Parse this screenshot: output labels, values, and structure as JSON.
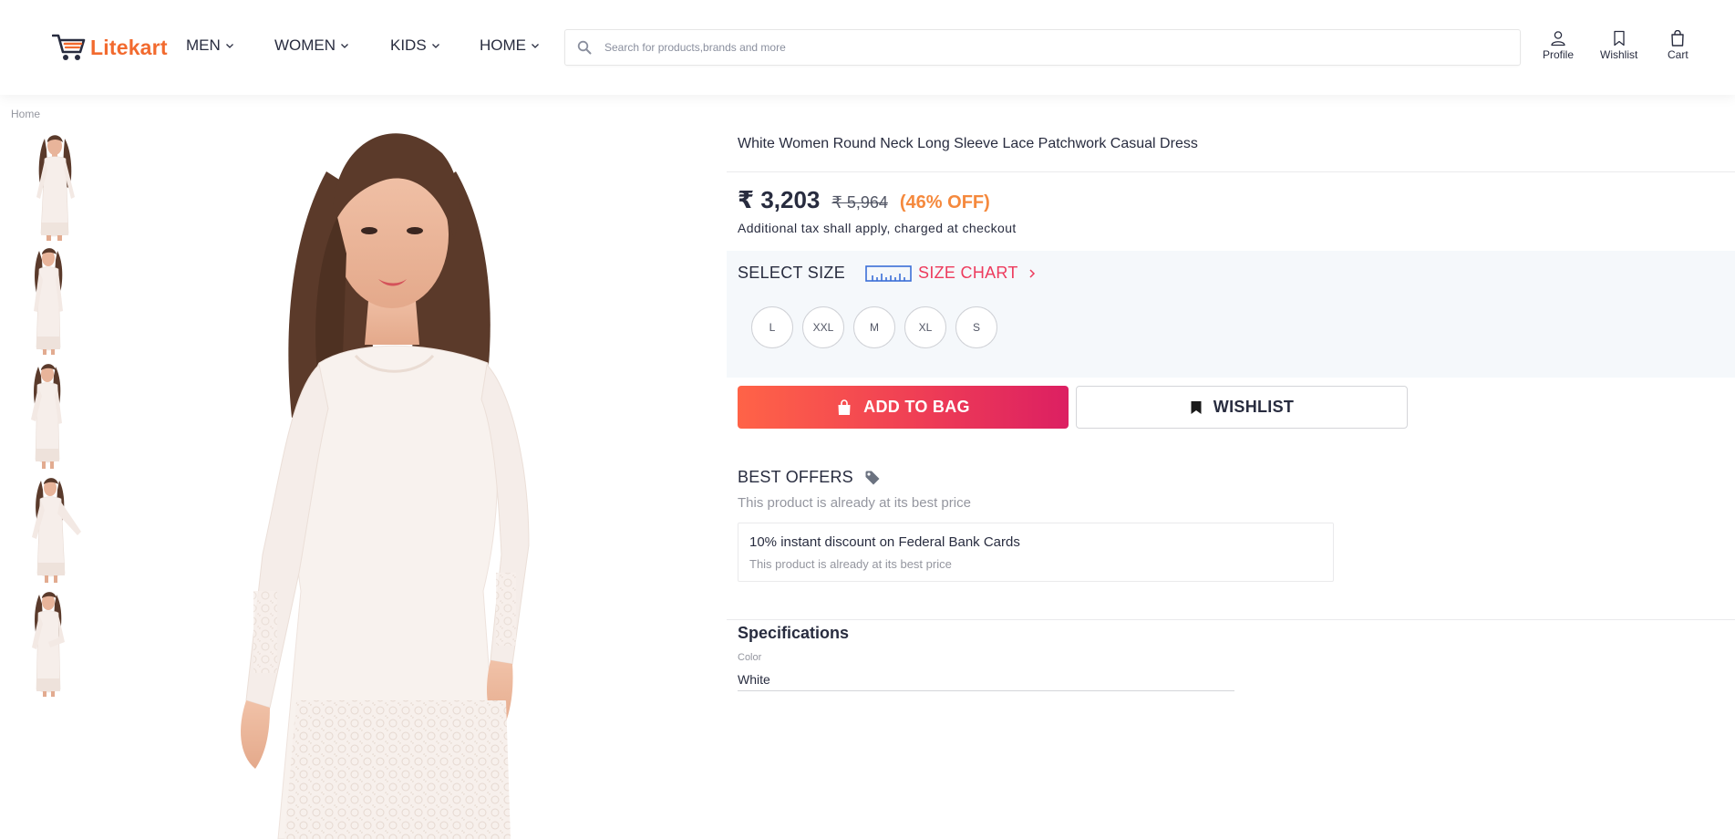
{
  "header": {
    "brand": "Litekart",
    "nav": [
      {
        "label": "MEN"
      },
      {
        "label": "WOMEN"
      },
      {
        "label": "KIDS"
      },
      {
        "label": "HOME"
      }
    ],
    "search_placeholder": "Search for products,brands and more",
    "actions": {
      "profile": "Profile",
      "wishlist": "Wishlist",
      "cart": "Cart"
    }
  },
  "breadcrumb": "Home",
  "gallery": {
    "thumbnail_count": 5
  },
  "product": {
    "title": "White Women Round Neck Long Sleeve Lace Patchwork Casual Dress",
    "price": "₹ 3,203",
    "mrp": "₹ 5,964",
    "discount": "(46% OFF)",
    "tax_note": "Additional tax shall apply, charged at checkout"
  },
  "size_section": {
    "heading": "SELECT SIZE",
    "chart_label": "SIZE CHART",
    "sizes": [
      "L",
      "XXL",
      "M",
      "XL",
      "S"
    ]
  },
  "buttons": {
    "add_to_bag": "ADD TO BAG",
    "wishlist": "WISHLIST"
  },
  "offers": {
    "heading": "BEST OFFERS",
    "subtext": "This product is already at its best price",
    "card": {
      "title": "10% instant discount on Federal Bank Cards",
      "subtitle": "This product is already at its best price"
    }
  },
  "specifications": {
    "heading": "Specifications",
    "items": [
      {
        "label": "Color",
        "value": "White"
      }
    ]
  },
  "colors": {
    "brand_orange": "#f26a2e",
    "discount_orange": "#f5893d",
    "size_chart_pink": "#ed3b5d",
    "bag_gradient_start": "#ff6347",
    "bag_gradient_end": "#dc1f62",
    "size_panel_bg": "#f5f8fb"
  }
}
